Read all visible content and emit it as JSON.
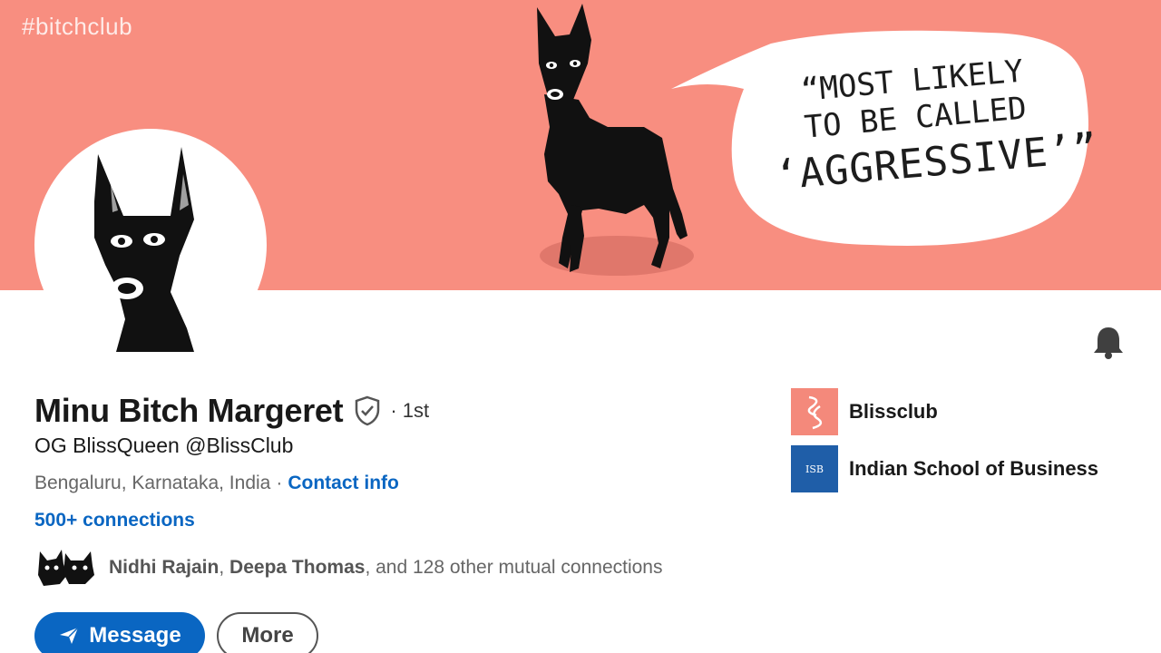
{
  "banner": {
    "hashtag": "#bitchclub",
    "speech_line1": "“MOST LIKELY",
    "speech_line2": "TO BE CALLED",
    "speech_line3": "‘AGGRESSIVE’”",
    "background_color": "#f88e80"
  },
  "profile": {
    "name": "Minu Bitch Margeret",
    "degree": "· 1st",
    "headline": "OG BlissQueen @BlissClub",
    "location": "Bengaluru, Karnataka, India",
    "separator": "·",
    "contact_info_label": "Contact info",
    "connections": "500+ connections",
    "mutual": {
      "name1": "Nidhi Rajain",
      "comma": ",",
      "name2": "Deepa Thomas",
      "rest": ", and 128 other mutual connections"
    }
  },
  "actions": {
    "message_label": "Message",
    "more_label": "More"
  },
  "organizations": [
    {
      "name": "Blissclub",
      "icon": "blissclub-logo"
    },
    {
      "name": "Indian School of Business",
      "icon": "isb-logo",
      "logo_text": "ISB"
    }
  ],
  "colors": {
    "accent": "#0a66c2",
    "banner": "#f88e80",
    "isb_blue": "#1f5ea8"
  }
}
